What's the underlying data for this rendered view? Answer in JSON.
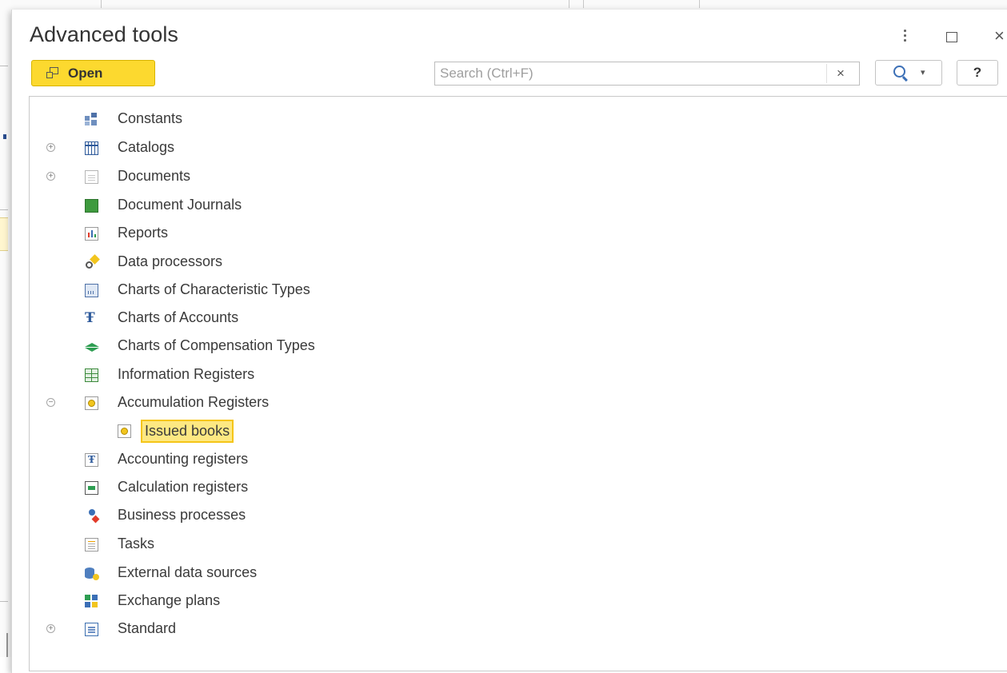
{
  "window": {
    "title": "Advanced tools",
    "more_icon": "more-vertical-icon",
    "maximize_icon": "maximize-icon",
    "close_label": "×"
  },
  "toolbar": {
    "open_label": "Open",
    "search_placeholder": "Search (Ctrl+F)",
    "search_value": "",
    "clear_label": "×",
    "search_button_caret": "▾",
    "help_label": "?",
    "accent_color": "#fcd92f"
  },
  "tree": {
    "items": [
      {
        "label": "Constants",
        "icon": "constants-icon",
        "expander": ""
      },
      {
        "label": "Catalogs",
        "icon": "catalogs-icon",
        "expander": "+"
      },
      {
        "label": "Documents",
        "icon": "documents-icon",
        "expander": "+"
      },
      {
        "label": "Document Journals",
        "icon": "journals-icon",
        "expander": ""
      },
      {
        "label": "Reports",
        "icon": "reports-icon",
        "expander": ""
      },
      {
        "label": "Data processors",
        "icon": "data-processors-icon",
        "expander": ""
      },
      {
        "label": "Charts of Characteristic Types",
        "icon": "characteristic-types-icon",
        "expander": ""
      },
      {
        "label": "Charts of Accounts",
        "icon": "charts-of-accounts-icon",
        "expander": ""
      },
      {
        "label": "Charts of Compensation Types",
        "icon": "compensation-types-icon",
        "expander": ""
      },
      {
        "label": "Information Registers",
        "icon": "information-registers-icon",
        "expander": ""
      },
      {
        "label": "Accumulation Registers",
        "icon": "accumulation-registers-icon",
        "expander": "−"
      },
      {
        "label": "Issued books",
        "icon": "accumulation-register-icon",
        "expander": "",
        "selected": true
      },
      {
        "label": "Accounting registers",
        "icon": "accounting-registers-icon",
        "expander": ""
      },
      {
        "label": "Calculation registers",
        "icon": "calculation-registers-icon",
        "expander": ""
      },
      {
        "label": "Business processes",
        "icon": "business-processes-icon",
        "expander": ""
      },
      {
        "label": "Tasks",
        "icon": "tasks-icon",
        "expander": ""
      },
      {
        "label": "External data sources",
        "icon": "external-data-sources-icon",
        "expander": ""
      },
      {
        "label": "Exchange plans",
        "icon": "exchange-plans-icon",
        "expander": ""
      },
      {
        "label": "Standard",
        "icon": "standard-icon",
        "expander": "+"
      }
    ],
    "selection_color": "#fde882"
  }
}
